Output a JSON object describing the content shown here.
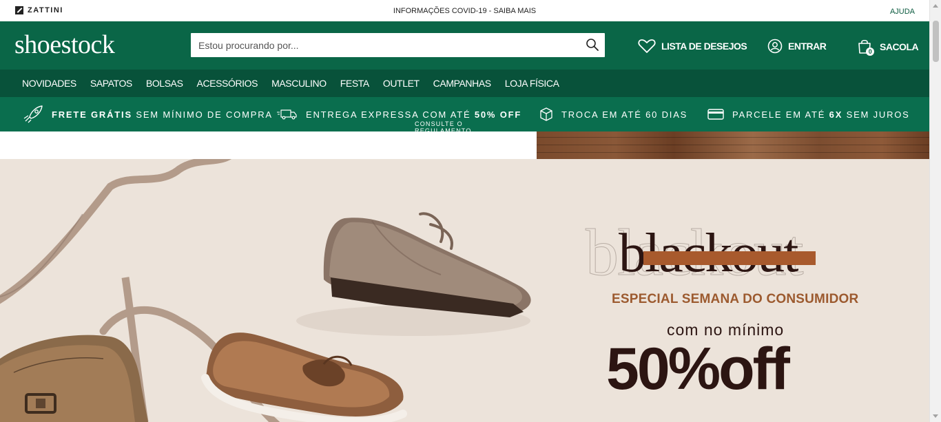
{
  "topbar": {
    "brand": "ZATTINI",
    "announcement": "INFORMAÇÕES COVID-19 - SAIBA MAIS",
    "help": "AJUDA"
  },
  "header": {
    "logo": "shoestock",
    "search_placeholder": "Estou procurando por...",
    "wishlist": "LISTA DE DESEJOS",
    "login": "ENTRAR",
    "bag": "SACOLA",
    "bag_count": "0"
  },
  "nav": {
    "items": [
      "NOVIDADES",
      "SAPATOS",
      "BOLSAS",
      "ACESSÓRIOS",
      "MASCULINO",
      "FESTA",
      "OUTLET",
      "CAMPANHAS",
      "LOJA FÍSICA"
    ]
  },
  "benefits": {
    "b1_bold": "FRETE GRÁTIS",
    "b1_rest": " SEM MÍNIMO DE COMPRA",
    "b2_text": "ENTREGA EXPRESSA COM ATÉ ",
    "b2_bold": "50% OFF",
    "b2_sub": "CONSULTE O REGULAMENTO",
    "b3_text": "TROCA EM ATÉ 60 DIAS",
    "b4_text": "PARCELE EM ATÉ ",
    "b4_bold": "6X",
    "b4_rest": " SEM JUROS"
  },
  "hero": {
    "ghost_word": "blackout",
    "headline": "blackout",
    "kicker": "ESPECIAL SEMANA DO CONSUMIDOR",
    "minimum": "com no mínimo",
    "discount": "50%off"
  },
  "colors": {
    "brand_green": "#0a6647",
    "nav_green": "#08523a",
    "benefits_green": "#0a6e4e",
    "hero_bg": "#ece3da",
    "promo_brown": "#9c5a2f",
    "promo_dark": "#2c1512"
  }
}
